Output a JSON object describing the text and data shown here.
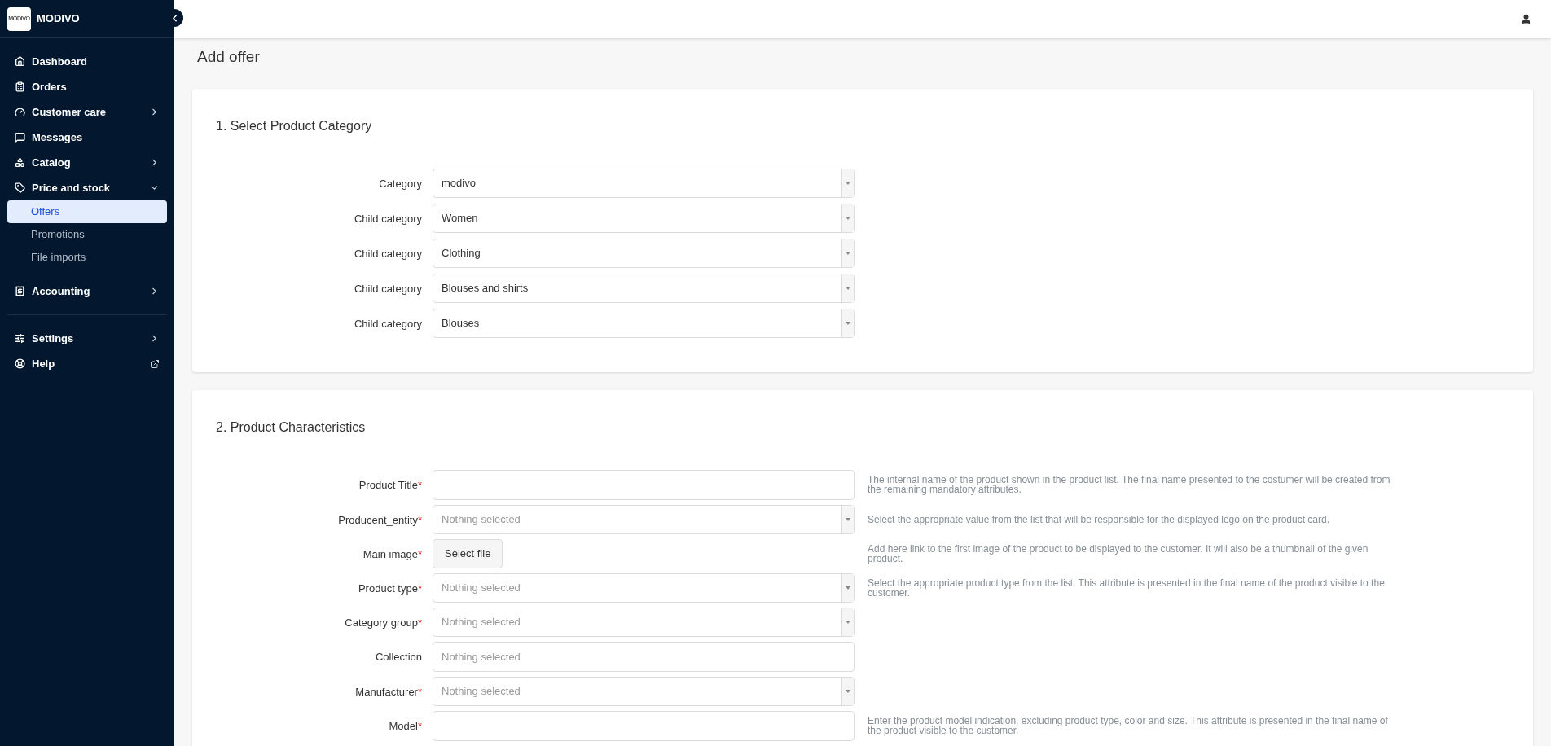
{
  "brand": {
    "logo": "MODIVO",
    "name": "MODIVO"
  },
  "sidebar": {
    "sections": [
      [
        {
          "label": "Dashboard",
          "kind": "link"
        },
        {
          "label": "Orders",
          "kind": "link"
        },
        {
          "label": "Customer care",
          "kind": "group",
          "expanded": false
        },
        {
          "label": "Messages",
          "kind": "link"
        },
        {
          "label": "Catalog",
          "kind": "group",
          "expanded": false
        },
        {
          "label": "Price and stock",
          "kind": "group",
          "expanded": true,
          "children": [
            {
              "label": "Offers",
              "selected": true
            },
            {
              "label": "Promotions",
              "selected": false
            },
            {
              "label": "File imports",
              "selected": false
            }
          ]
        },
        {
          "label": "Accounting",
          "kind": "group",
          "expanded": false
        }
      ],
      [
        {
          "label": "Settings",
          "kind": "group",
          "expanded": false
        },
        {
          "label": "Help",
          "kind": "external"
        }
      ]
    ]
  },
  "page_title": "Add offer",
  "sections": [
    {
      "title": "1. Select Product Category",
      "fields": [
        {
          "label": "Category",
          "kind": "select",
          "value": "modivo"
        },
        {
          "label": "Child category",
          "kind": "select",
          "value": "Women"
        },
        {
          "label": "Child category",
          "kind": "select",
          "value": "Clothing"
        },
        {
          "label": "Child category",
          "kind": "select",
          "value": "Blouses and shirts"
        },
        {
          "label": "Child category",
          "kind": "select",
          "value": "Blouses"
        }
      ]
    },
    {
      "title": "2. Product Characteristics",
      "fields": [
        {
          "label": "Product Title",
          "kind": "text",
          "required_mark": "*",
          "help": "The internal name of the product shown in the product list. The final name presented to the costumer will be created from the remaining mandatory attributes."
        },
        {
          "label": "Producent_entity",
          "kind": "select",
          "placeholder": "Nothing selected",
          "required_mark": "*",
          "help": "Select the appropriate value from the list that will be responsible for the displayed logo on the product card."
        },
        {
          "label": "Main image",
          "kind": "file",
          "button": "Select file",
          "required_mark": "*",
          "help": "Add here link to the first image of the product to be displayed to the customer. It will also be a thumbnail of the given product."
        },
        {
          "label": "Product type",
          "kind": "select",
          "placeholder": "Nothing selected",
          "required_mark": "*",
          "help": "Select the appropriate product type from the list. This attribute is presented in the final name of the product visible to the customer."
        },
        {
          "label": "Category group",
          "kind": "select",
          "placeholder": "Nothing selected",
          "required_mark": "*"
        },
        {
          "label": "Collection",
          "kind": "text",
          "placeholder": "Nothing selected"
        },
        {
          "label": "Manufacturer",
          "kind": "select",
          "placeholder": "Nothing selected",
          "required_mark": "*"
        },
        {
          "label": "Model",
          "kind": "text",
          "required_mark": "*",
          "help": "Enter the product model indication, excluding product type, color and size. This attribute is presented in the final name of the product visible to the customer."
        }
      ]
    }
  ]
}
